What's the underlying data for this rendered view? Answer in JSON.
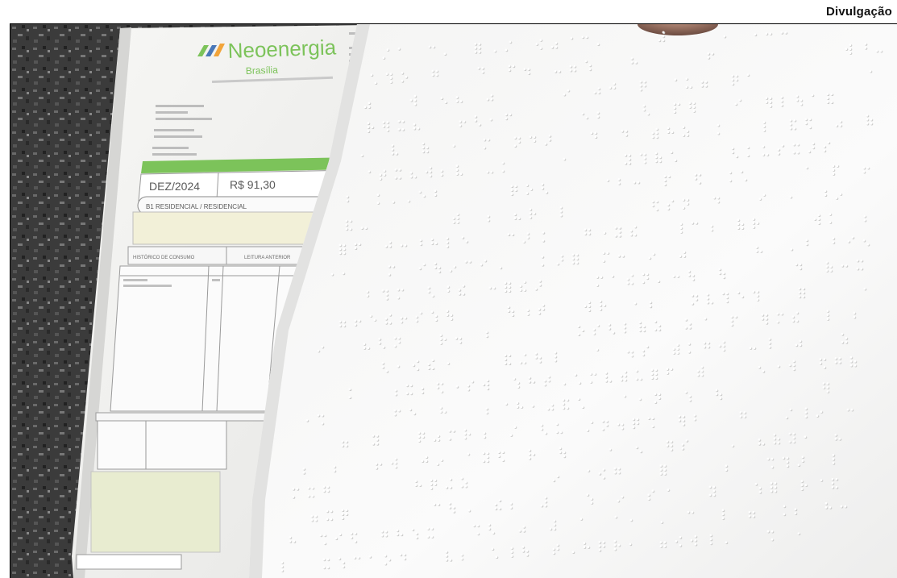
{
  "credit": "Divulgação",
  "bill": {
    "brand": "Neoenergia",
    "brand_sub": "Brasília",
    "month": "DEZ/2024",
    "amount": "R$ 91,30",
    "classification": "B1 RESIDENCIAL / RESIDENCIAL",
    "label_history": "HISTÓRICO DE CONSUMO",
    "label_reading": "LEITURA ANTERIOR"
  },
  "colors": {
    "brand_green": "#7cc35a",
    "brand_blue": "#4a78b8",
    "paper": "#f2f2f0",
    "braille_paper": "#f7f7f6",
    "granite": "#3c3c3c"
  }
}
